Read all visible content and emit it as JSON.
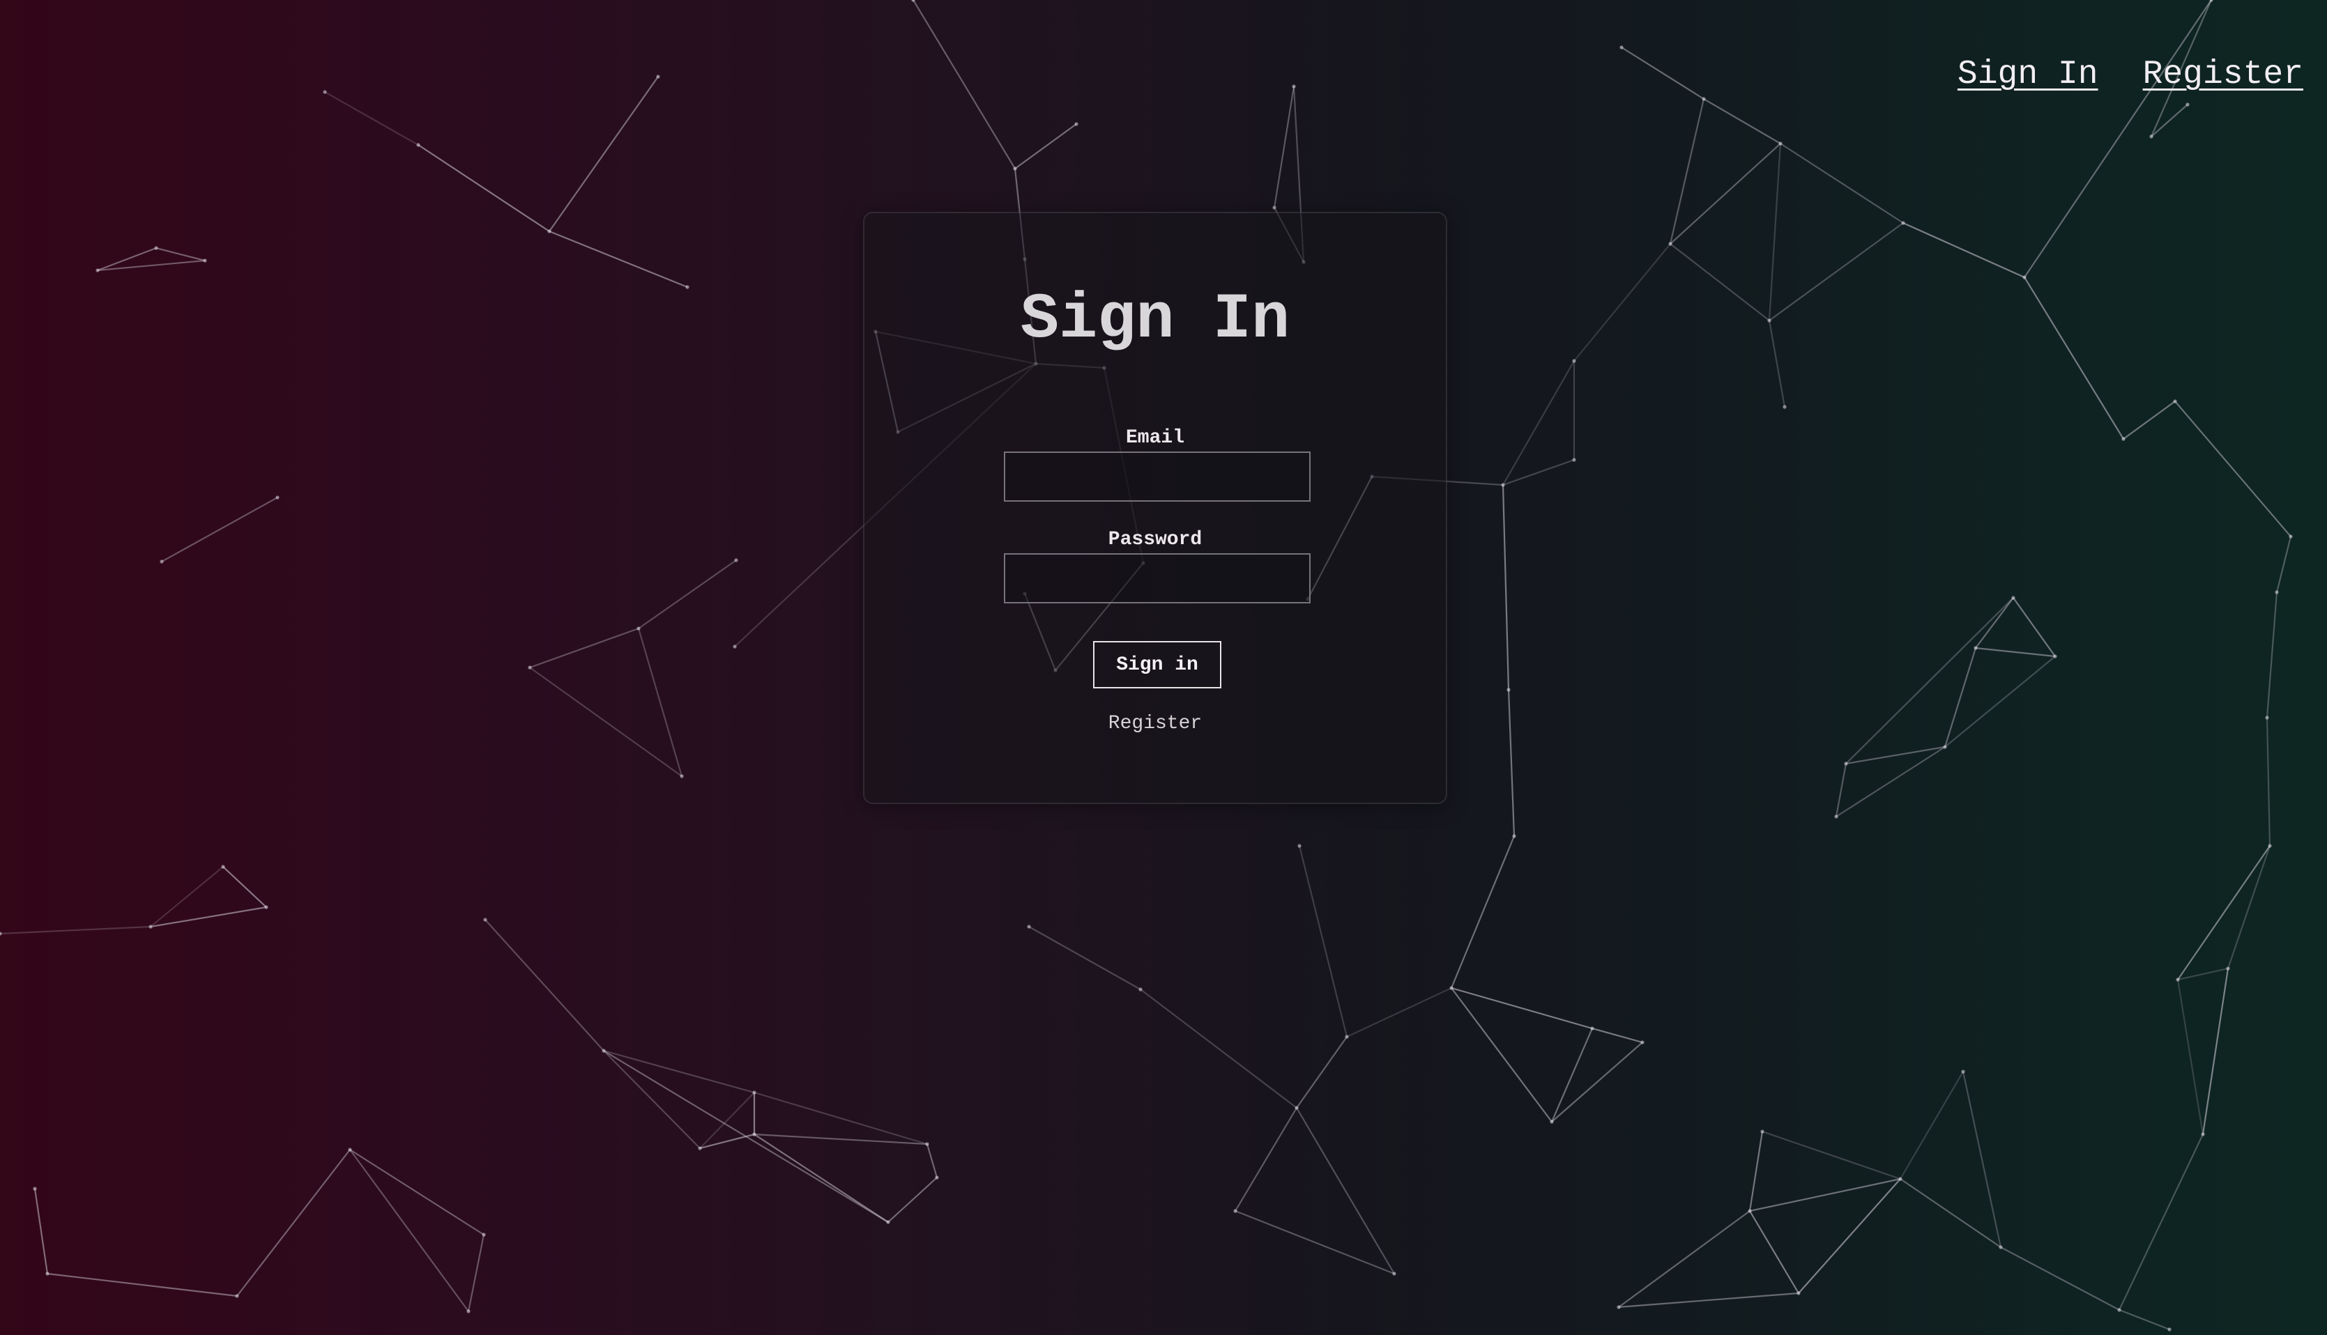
{
  "nav": {
    "sign_in": "Sign In",
    "register": "Register"
  },
  "form": {
    "title": "Sign In",
    "email_label": "Email",
    "email_value": "",
    "password_label": "Password",
    "password_value": "",
    "submit_label": "Sign in",
    "register_link": "Register"
  },
  "colors": {
    "background_left": "#330618",
    "background_right": "#0d2622",
    "text": "#e6e2e6"
  }
}
